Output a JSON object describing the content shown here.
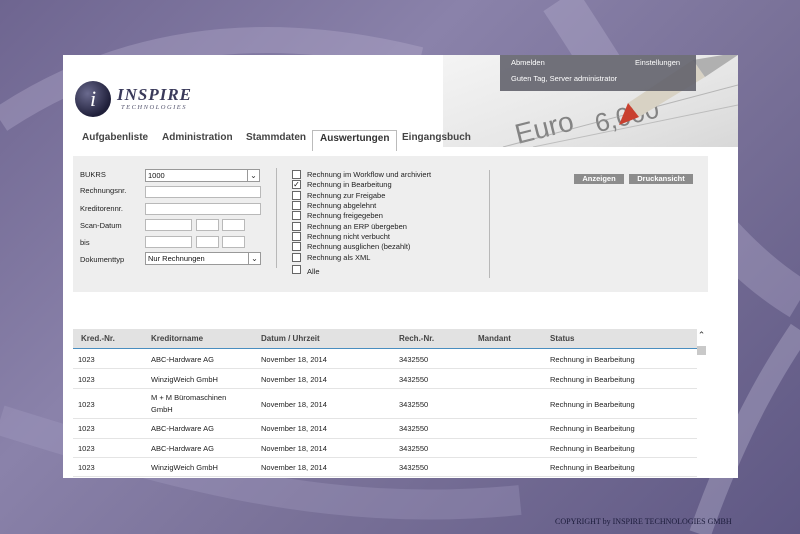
{
  "header": {
    "logo_name": "INSPIRE",
    "logo_subtitle": "TECHNOLOGIES",
    "logout_label": "Abmelden",
    "settings_label": "Einstellungen",
    "greeting": "Guten Tag, Server administrator"
  },
  "nav": {
    "tabs": [
      {
        "label": "Aufgabenliste"
      },
      {
        "label": "Administration"
      },
      {
        "label": "Stammdaten"
      },
      {
        "label": "Auswertungen"
      },
      {
        "label": "Eingangsbuch"
      }
    ],
    "active": "Auswertungen"
  },
  "filter": {
    "bukrs_label": "BUKRS",
    "bukrs_value": "1000",
    "rechnungsnr_label": "Rechnungsnr.",
    "kreditorennr_label": "Kreditorennr.",
    "scan_datum_label": "Scan-Datum",
    "bis_label": "bis",
    "dokumenttyp_label": "Dokumenttyp",
    "dokumenttyp_value": "Nur Rechnungen",
    "checkboxes": [
      {
        "label": "Rechnung im Workflow und archiviert",
        "checked": false
      },
      {
        "label": "Rechnung in Bearbeitung",
        "checked": true
      },
      {
        "label": "Rechnung zur Freigabe",
        "checked": false
      },
      {
        "label": "Rechnung abgelehnt",
        "checked": false
      },
      {
        "label": "Rechnung freigegeben",
        "checked": false
      },
      {
        "label": "Rechnung an ERP übergeben",
        "checked": false
      },
      {
        "label": "Rechnung nicht verbucht",
        "checked": false
      },
      {
        "label": "Rechnung ausglichen (bezahlt)",
        "checked": false
      },
      {
        "label": "Rechnung als XML",
        "checked": false
      },
      {
        "label": "Alle",
        "checked": false
      }
    ],
    "show_button": "Anzeigen",
    "print_button": "Druckansicht"
  },
  "table": {
    "columns": [
      "Kred.-Nr.",
      "Kreditorname",
      "Datum / Uhrzeit",
      "Rech.-Nr.",
      "Mandant",
      "Status"
    ],
    "rows": [
      {
        "kred": "1023",
        "name": "ABC-Hardware AG",
        "name2": "",
        "datum": "November 18, 2014",
        "rech": "3432550",
        "mandant": "",
        "status": "Rechnung in Bearbeitung"
      },
      {
        "kred": "1023",
        "name": "WinzigWeich GmbH",
        "name2": "",
        "datum": "November 18, 2014",
        "rech": "3432550",
        "mandant": "",
        "status": "Rechnung in Bearbeitung"
      },
      {
        "kred": "1023",
        "name": "M + M Büromaschinen",
        "name2": "GmbH",
        "datum": "November 18, 2014",
        "rech": "3432550",
        "mandant": "",
        "status": "Rechnung in Bearbeitung"
      },
      {
        "kred": "1023",
        "name": "ABC-Hardware AG",
        "name2": "",
        "datum": "November 18, 2014",
        "rech": "3432550",
        "mandant": "",
        "status": "Rechnung in Bearbeitung"
      },
      {
        "kred": "1023",
        "name": "ABC-Hardware AG",
        "name2": "",
        "datum": "November 18, 2014",
        "rech": "3432550",
        "mandant": "",
        "status": "Rechnung in Bearbeitung"
      },
      {
        "kred": "1023",
        "name": "WinzigWeich GmbH",
        "name2": "",
        "datum": "November 18, 2014",
        "rech": "3432550",
        "mandant": "",
        "status": "Rechnung in Bearbeitung"
      }
    ]
  },
  "footer": {
    "copyright": "COPYRIGHT by INSPIRE TECHNOLOGIES GMBH"
  },
  "colors": {
    "accent_line": "#4a8ec0",
    "button_gray": "#8c8c8c",
    "background": "#7a7299"
  }
}
